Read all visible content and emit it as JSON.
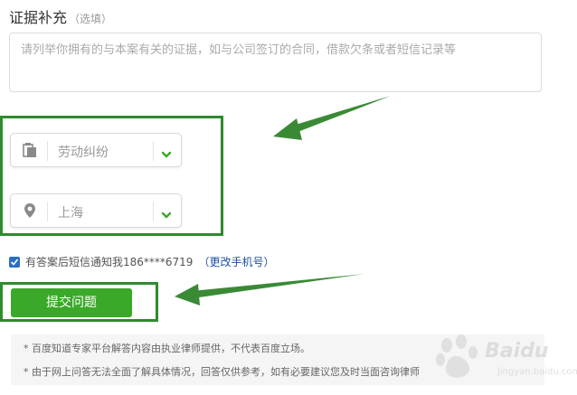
{
  "form": {
    "title": "证据补充",
    "title_hint": "（选填）",
    "evidence_placeholder": "请列举你拥有的与本案有关的证据，如与公司签订的合同，借款欠条或者短信记录等"
  },
  "selects": {
    "category": {
      "value": "劳动纠纷",
      "icon": "clipboard-icon"
    },
    "location": {
      "value": "上海",
      "icon": "location-pin-icon"
    }
  },
  "notify": {
    "checked": true,
    "text": "有答案后短信通知我186****6719",
    "link": "（更改手机号）"
  },
  "submit": {
    "label": "提交问题"
  },
  "disclaimer": {
    "line1": "* 百度知道专家平台解答内容由执业律师提供，不代表百度立场。",
    "line2": "* 由于网上问答无法全面了解具体情况，回答仅供参考，如有必要建议您及时当面咨询律师"
  },
  "watermark": {
    "brand": "Baidu",
    "sub": "jingyan.baidu.com"
  },
  "colors": {
    "accent_green": "#3aa828",
    "highlight_green": "#2e8b2e",
    "link_blue": "#2050a0",
    "checkbox_blue": "#2b6ec2"
  }
}
